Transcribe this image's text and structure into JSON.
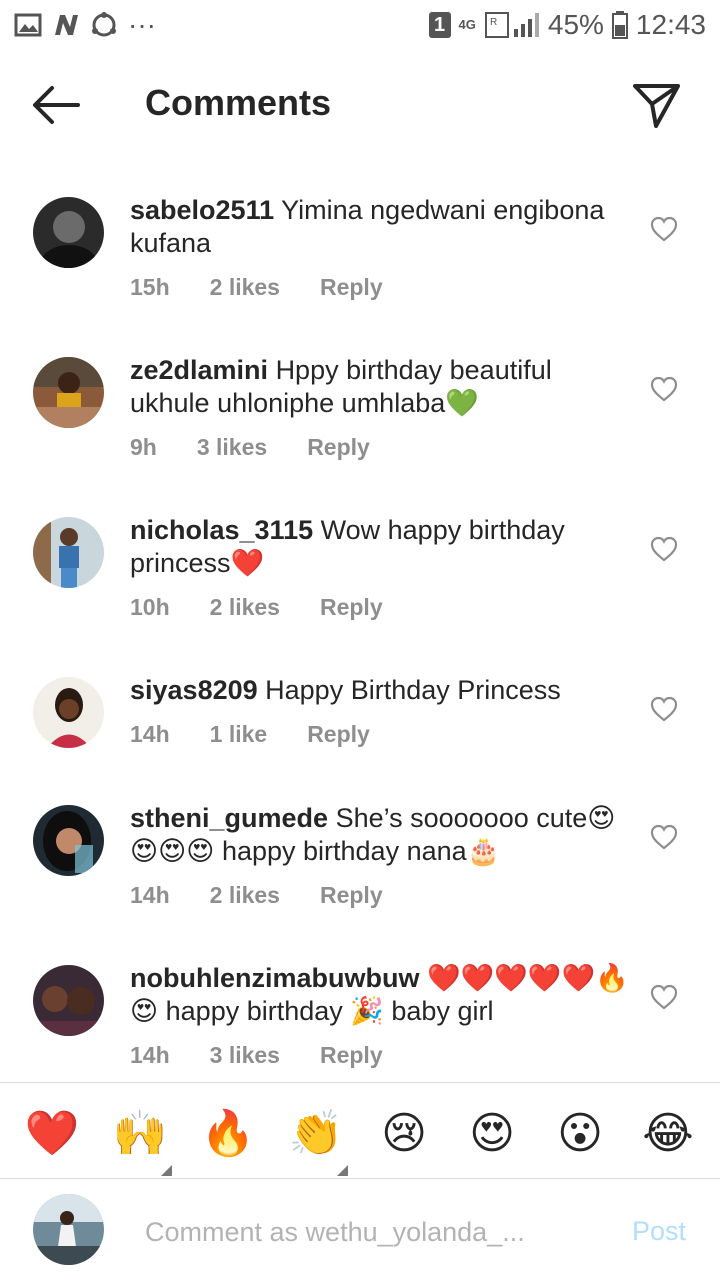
{
  "status_bar": {
    "sim_badge": "1",
    "network": "4G",
    "battery": "45%",
    "time": "12:43",
    "more": "···"
  },
  "header": {
    "title": "Comments",
    "back_icon": "arrow-left-icon",
    "share_icon": "paper-plane-icon"
  },
  "comments": [
    {
      "username": "sabelo2511",
      "text": "Yimina ngedwani engibona kufana",
      "time": "15h",
      "likes": "2 likes",
      "reply": "Reply"
    },
    {
      "username": "ze2dlamini",
      "text": "Hppy birthday beautiful ukhule uhloniphe umhlaba💚",
      "time": "9h",
      "likes": "3 likes",
      "reply": "Reply"
    },
    {
      "username": "nicholas_3115",
      "text": "Wow happy birthday princess❤️",
      "time": "10h",
      "likes": "2 likes",
      "reply": "Reply"
    },
    {
      "username": "siyas8209",
      "text": "Happy Birthday Princess",
      "time": "14h",
      "likes": "1 like",
      "reply": "Reply"
    },
    {
      "username": "stheni_gumede",
      "text": "She’s sooooooo cute😍😍😍😍 happy birthday nana🎂",
      "time": "14h",
      "likes": "2 likes",
      "reply": "Reply"
    },
    {
      "username": "nobuhlenzimabuwbuw",
      "text": "❤️❤️❤️❤️❤️🔥😍 happy birthday 🎉 baby girl",
      "time": "14h",
      "likes": "3 likes",
      "reply": "Reply"
    }
  ],
  "emoji_bar": [
    "❤️",
    "🙌",
    "🔥",
    "👏",
    "😢",
    "😍",
    "😮",
    "😂"
  ],
  "input": {
    "placeholder": "Comment as wethu_yolanda_...",
    "post_label": "Post"
  },
  "colors": {
    "text": "#262626",
    "meta": "#8e8e8e",
    "post_disabled": "#b2dffc",
    "divider": "#dbdbdb"
  }
}
